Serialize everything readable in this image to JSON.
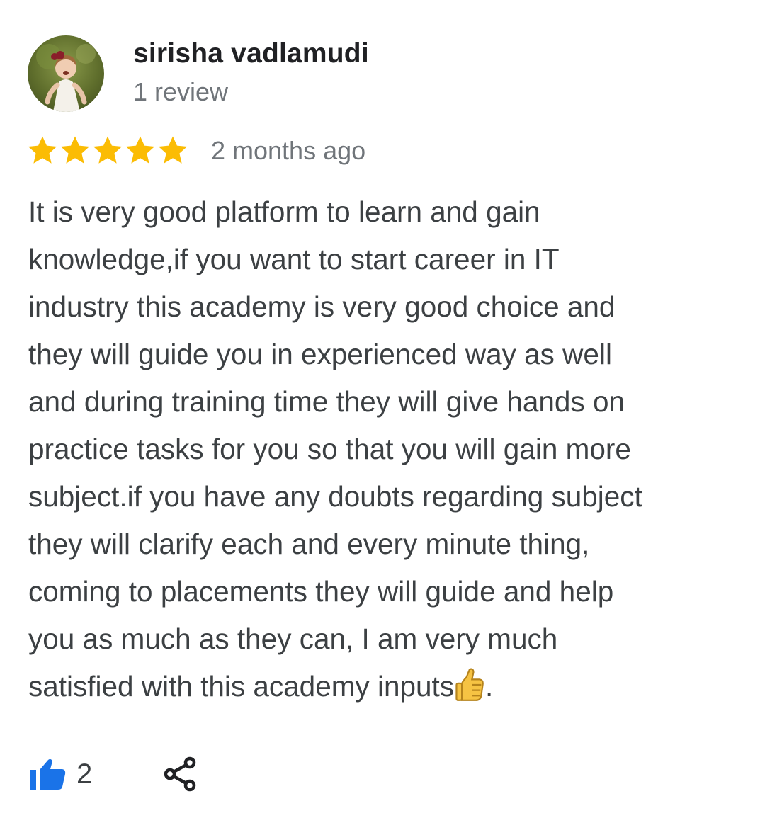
{
  "reviewer": {
    "name": "sirisha vadlamudi",
    "review_count": "1 review",
    "avatar_icon": "profile-photo"
  },
  "rating": {
    "stars": 5,
    "max_stars": 5,
    "star_color": "#fbbc04",
    "time_ago": "2 months ago"
  },
  "review": {
    "lines": [
      "It is very good platform to learn and gain",
      "knowledge,if you want to start career in IT",
      "industry this academy is very good choice and",
      "they will guide you in experienced way as well",
      "and during training time they will give hands on",
      "practice tasks for you so that you will gain more",
      "subject.if you have any doubts regarding subject",
      "they will clarify each and every minute thing,",
      "coming to placements they will guide and help",
      "you as much as they can, I am very much",
      "satisfied with this academy inputs"
    ],
    "trailing": ".",
    "emoji_icon": "thumbs-up-emoji"
  },
  "actions": {
    "like_icon": "thumbs-up-icon",
    "like_count": "2",
    "like_color": "#1a73e8",
    "share_icon": "share-icon"
  }
}
